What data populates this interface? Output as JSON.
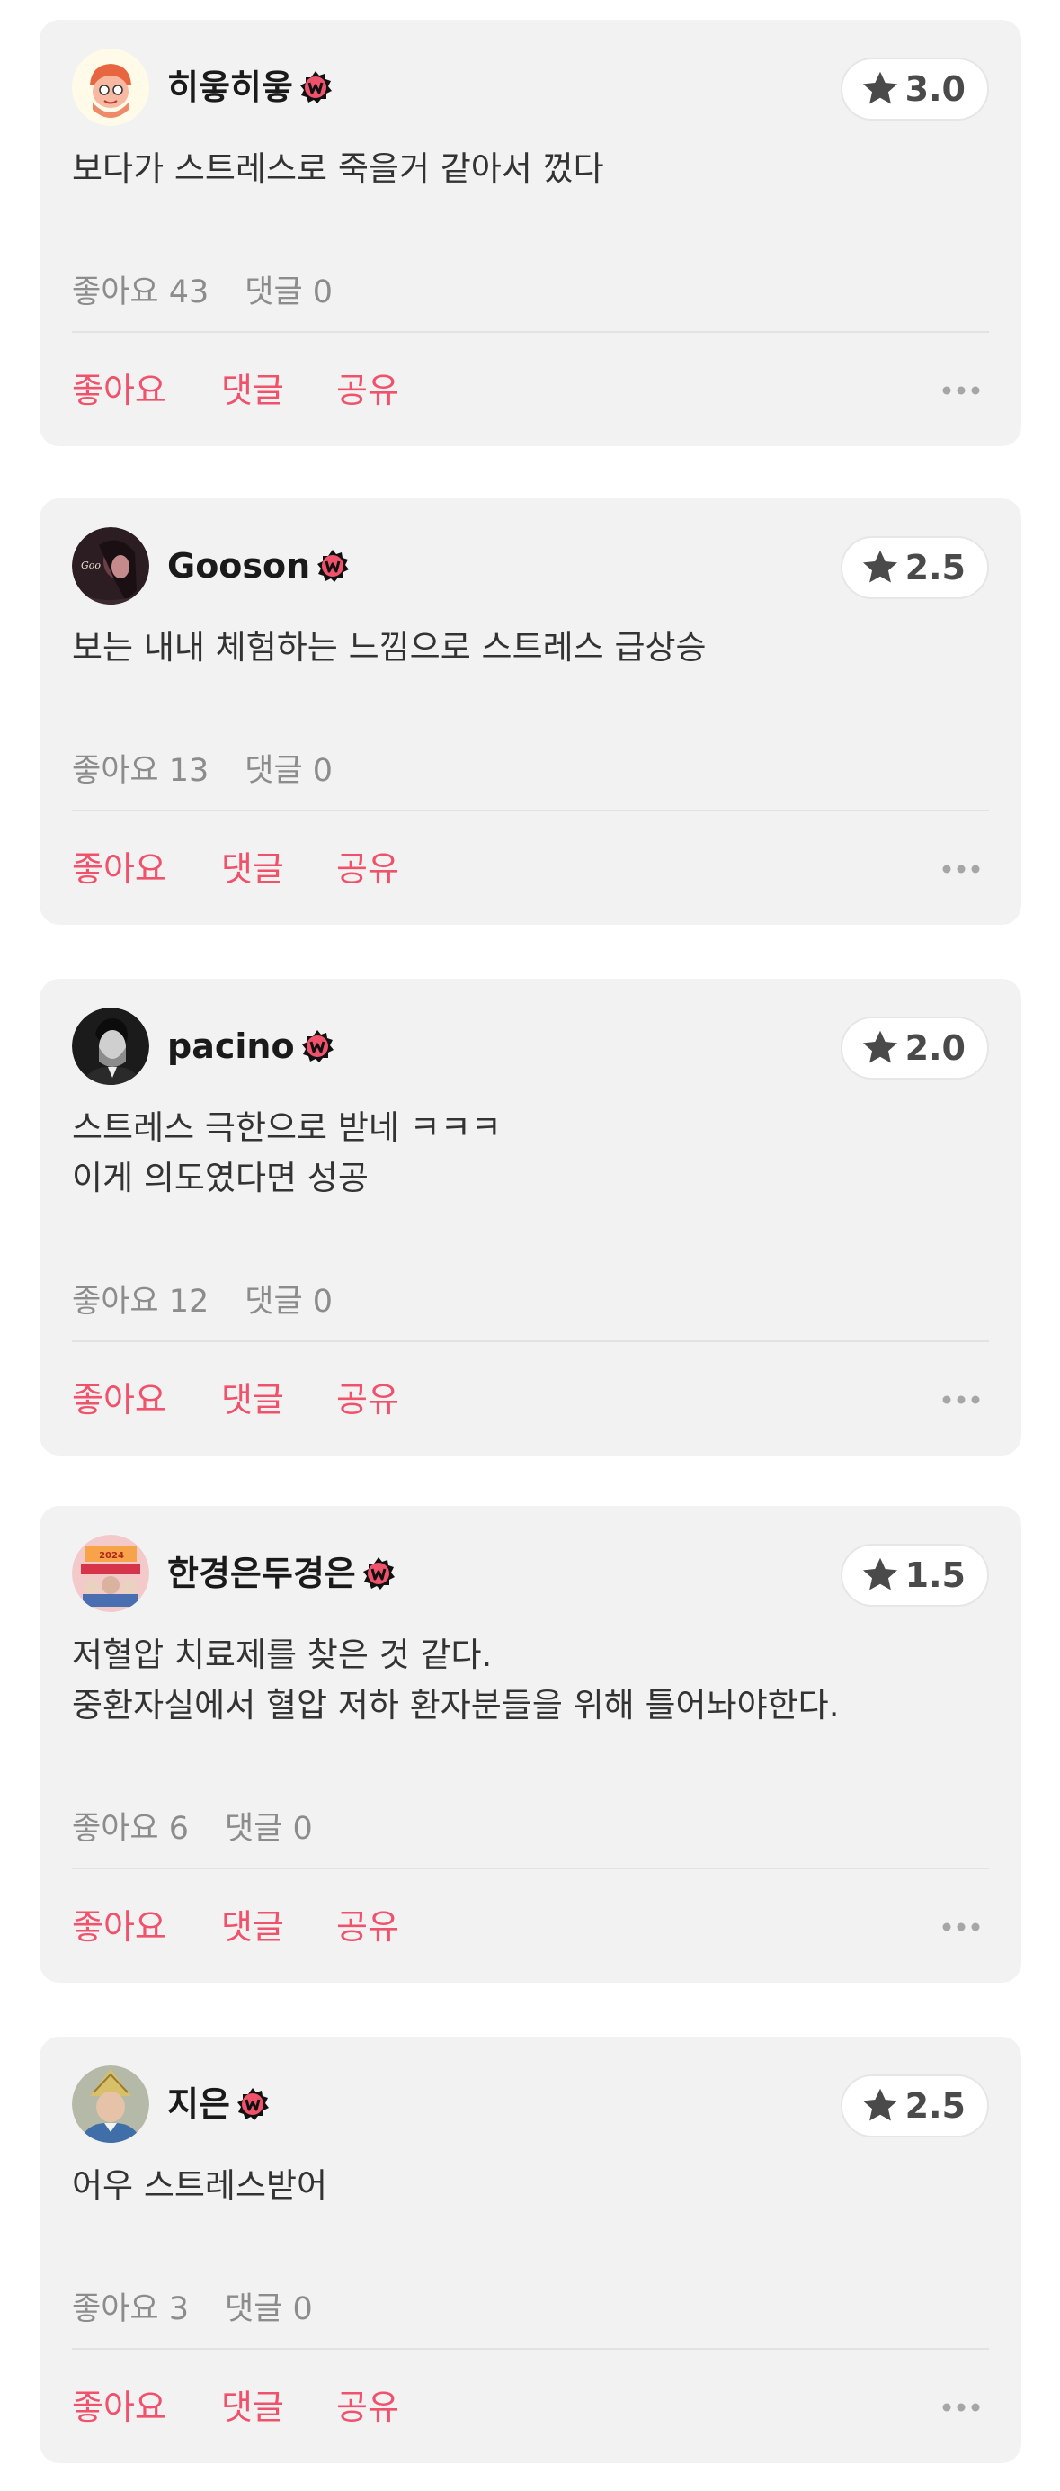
{
  "accent_color": "#f0526b",
  "reviews": [
    {
      "username": "히읗히읗",
      "badge_icon": "watcha-badge-icon",
      "avatar_icon": "cartoon-face-avatar",
      "rating": "3.0",
      "lines": [
        "보다가 스트레스로 죽을거 같아서 껐다"
      ],
      "likes_text": "좋아요 43",
      "comments_text": "댓글 0",
      "actions": {
        "like": "좋아요",
        "comment": "댓글",
        "share": "공유"
      }
    },
    {
      "username": "Gooson",
      "badge_icon": "watcha-badge-icon",
      "avatar_icon": "photo-avatar",
      "rating": "2.5",
      "lines": [
        "보는 내내 체험하는 느낌으로 스트레스 급상승"
      ],
      "likes_text": "좋아요 13",
      "comments_text": "댓글 0",
      "actions": {
        "like": "좋아요",
        "comment": "댓글",
        "share": "공유"
      }
    },
    {
      "username": "pacino",
      "badge_icon": "watcha-badge-icon",
      "avatar_icon": "portrait-avatar",
      "rating": "2.0",
      "lines": [
        "스트레스 극한으로 받네 ㅋㅋㅋ",
        "이게 의도였다면 성공"
      ],
      "likes_text": "좋아요 12",
      "comments_text": "댓글 0",
      "actions": {
        "like": "좋아요",
        "comment": "댓글",
        "share": "공유"
      }
    },
    {
      "username": "한경은두경은",
      "badge_icon": "watcha-badge-icon",
      "avatar_icon": "poster-avatar",
      "rating": "1.5",
      "lines": [
        "저혈압 치료제를 찾은 것 같다.",
        "중환자실에서 혈압 저하 환자분들을 위해 틀어놔야한다."
      ],
      "likes_text": "좋아요 6",
      "comments_text": "댓글 0",
      "actions": {
        "like": "좋아요",
        "comment": "댓글",
        "share": "공유"
      }
    },
    {
      "username": "지은",
      "badge_icon": "watcha-badge-icon",
      "avatar_icon": "person-avatar",
      "rating": "2.5",
      "lines": [
        "어우 스트레스받어"
      ],
      "likes_text": "좋아요 3",
      "comments_text": "댓글 0",
      "actions": {
        "like": "좋아요",
        "comment": "댓글",
        "share": "공유"
      }
    }
  ]
}
